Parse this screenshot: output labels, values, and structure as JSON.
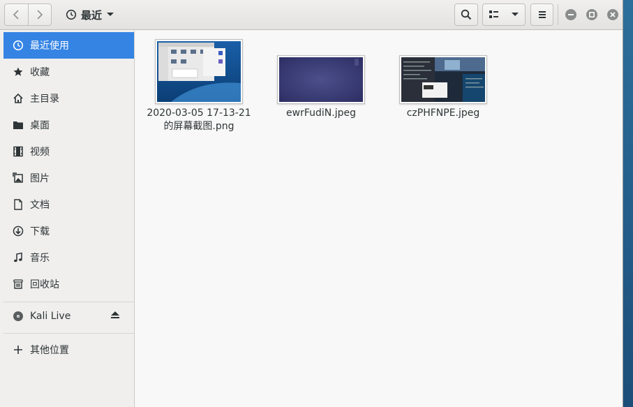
{
  "header": {
    "location_label": "最近",
    "back_icon": "chevron-left-icon",
    "forward_icon": "chevron-right-icon",
    "history_icon": "clock-icon"
  },
  "sidebar": {
    "items": [
      {
        "label": "最近使用",
        "icon": "clock-icon",
        "active": true
      },
      {
        "label": "收藏",
        "icon": "star-icon"
      },
      {
        "label": "主目录",
        "icon": "home-icon"
      },
      {
        "label": "桌面",
        "icon": "folder-icon"
      },
      {
        "label": "视频",
        "icon": "film-icon"
      },
      {
        "label": "图片",
        "icon": "picture-icon"
      },
      {
        "label": "文档",
        "icon": "document-icon"
      },
      {
        "label": "下载",
        "icon": "download-icon"
      },
      {
        "label": "音乐",
        "icon": "music-icon"
      },
      {
        "label": "回收站",
        "icon": "trash-icon"
      }
    ],
    "device": {
      "label": "Kali Live",
      "icon": "disc-icon"
    },
    "other": {
      "label": "其他位置",
      "icon": "plus-icon"
    }
  },
  "files": [
    {
      "name": "2020-03-05 17-13-21 的屏幕截图.png"
    },
    {
      "name": "ewrFudiN.jpeg"
    },
    {
      "name": "czPHFNPE.jpeg"
    }
  ],
  "colors": {
    "accent": "#3584e4",
    "wallpaper": "#1f5c8a"
  }
}
